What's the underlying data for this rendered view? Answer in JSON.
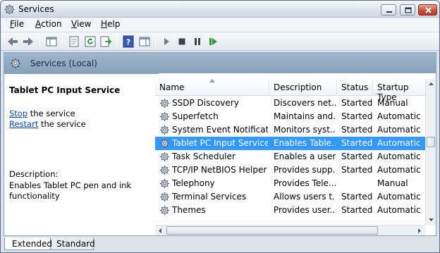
{
  "window": {
    "title": "Services"
  },
  "menu": {
    "items": [
      {
        "mnemonic": "F",
        "rest": "ile"
      },
      {
        "mnemonic": "A",
        "rest": "ction"
      },
      {
        "mnemonic": "V",
        "rest": "iew"
      },
      {
        "mnemonic": "H",
        "rest": "elp"
      }
    ]
  },
  "toolbar": {
    "icons": [
      "back-icon",
      "forward-icon",
      "show-console-tree-icon",
      "properties-icon",
      "refresh-icon",
      "export-list-icon",
      "help-icon",
      "show-action-pane-icon",
      "start-service-icon",
      "stop-service-icon",
      "pause-service-icon",
      "resume-service-icon"
    ]
  },
  "pane": {
    "title": "Services (Local)"
  },
  "details": {
    "service_name": "Tablet PC Input Service",
    "stop_link": "Stop",
    "stop_rest": " the service",
    "restart_link": "Restart",
    "restart_rest": " the service",
    "description_label": "Description:",
    "description_text": "Enables Tablet PC pen and ink functionality"
  },
  "list": {
    "columns": {
      "name": "Name",
      "description": "Description",
      "status": "Status",
      "startup": "Startup Type"
    },
    "rows": [
      {
        "name": "SSDP Discovery",
        "description": "Discovers net...",
        "status": "Started",
        "startup": "Manual",
        "selected": false
      },
      {
        "name": "Superfetch",
        "description": "Maintains and...",
        "status": "Started",
        "startup": "Automatic",
        "selected": false
      },
      {
        "name": "System Event Notificati...",
        "description": "Monitors syst...",
        "status": "Started",
        "startup": "Automatic",
        "selected": false
      },
      {
        "name": "Tablet PC Input Service",
        "description": "Enables Table...",
        "status": "Started",
        "startup": "Automatic",
        "selected": true
      },
      {
        "name": "Task Scheduler",
        "description": "Enables a user...",
        "status": "Started",
        "startup": "Automatic",
        "selected": false
      },
      {
        "name": "TCP/IP NetBIOS Helper",
        "description": "Provides supp...",
        "status": "Started",
        "startup": "Automatic",
        "selected": false
      },
      {
        "name": "Telephony",
        "description": "Provides Tele...",
        "status": "",
        "startup": "Manual",
        "selected": false
      },
      {
        "name": "Terminal Services",
        "description": "Allows users t...",
        "status": "Started",
        "startup": "Automatic",
        "selected": false
      },
      {
        "name": "Themes",
        "description": "Provides user...",
        "status": "Started",
        "startup": "Automatic",
        "selected": false
      }
    ]
  },
  "tabs": {
    "extended": "Extended",
    "standard": "Standard",
    "active": "Extended"
  },
  "colors": {
    "selection": "#3399ff",
    "header": "#869fba",
    "link": "#0645ad"
  }
}
